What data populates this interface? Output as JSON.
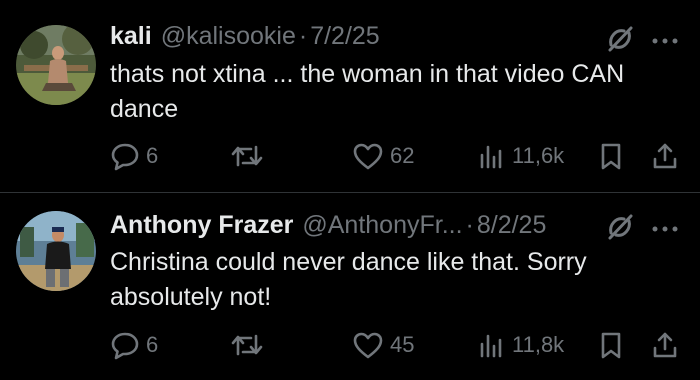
{
  "tweets": [
    {
      "display_name": "kali",
      "handle": "@kalisookie",
      "separator": "·",
      "date": "7/2/25",
      "text": "thats not xtina ... the woman in that video CAN dance",
      "replies": "6",
      "retweets": "",
      "likes": "62",
      "views": "11,6k"
    },
    {
      "display_name": "Anthony Frazer",
      "handle": "@AnthonyFr...",
      "separator": "·",
      "date": "8/2/25",
      "text": "Christina could never dance like that.  Sorry absolutely not!",
      "replies": "6",
      "retweets": "",
      "likes": "45",
      "views": "11,8k"
    }
  ],
  "colors": {
    "background": "#000000",
    "primary_text": "#e7e9ea",
    "secondary_text": "#71767b",
    "divider": "#2f3336"
  },
  "icons": [
    "grok-icon",
    "more-icon",
    "reply-icon",
    "retweet-icon",
    "like-icon",
    "views-icon",
    "bookmark-icon",
    "share-icon"
  ]
}
